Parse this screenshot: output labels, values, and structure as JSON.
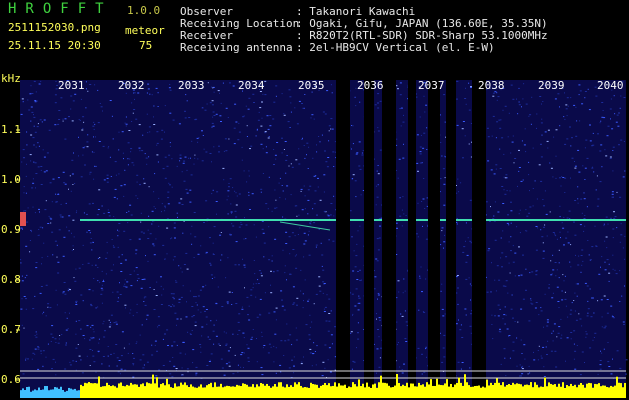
{
  "app": {
    "name": "HROFFT",
    "version": "1.0.0",
    "filename": "2511152030.png",
    "datetime": "25.11.15 20:30",
    "meteor_label": "meteor",
    "meteor_count": "75"
  },
  "info": {
    "rows": [
      {
        "label": "Observer",
        "value": ": Takanori Kawachi"
      },
      {
        "label": "Receiving Location",
        "value": ": Ogaki, Gifu, JAPAN (136.60E, 35.35N)"
      },
      {
        "label": "Receiver",
        "value": ": R820T2(RTL-SDR) SDR-Sharp 53.1000MHz"
      },
      {
        "label": "Receiving antenna",
        "value": ": 2el-HB9CV Vertical (el. E-W)"
      }
    ]
  },
  "chart_data": {
    "type": "heatmap",
    "ylabel": "kHz",
    "y_ticks": [
      "1.1",
      "1.0",
      "0.9",
      "0.8",
      "0.7",
      "0.6"
    ],
    "x_ticks": [
      "2031",
      "2032",
      "2033",
      "2034",
      "2035",
      "2036",
      "2037",
      "2038",
      "2039",
      "2040"
    ],
    "carrier_freq_khz": 0.92,
    "colors": {
      "background": "#0a0a4a",
      "noise": "#3a5aff",
      "carrier": "#40e0b0",
      "level": "#ffff00",
      "gap": "#000000"
    }
  }
}
